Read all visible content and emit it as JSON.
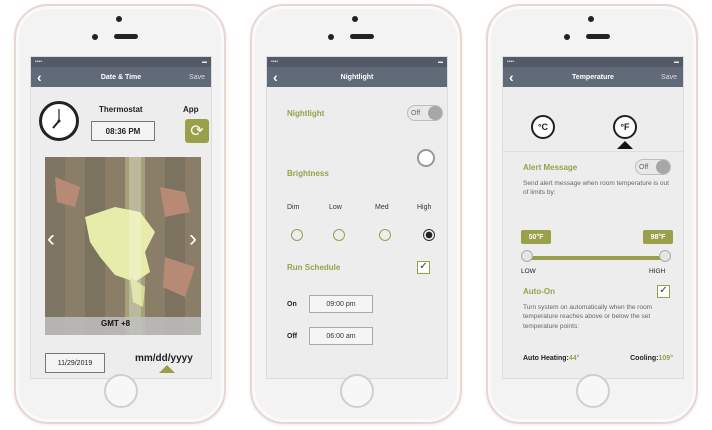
{
  "screens": {
    "date_time": {
      "nav": {
        "back": "‹",
        "title": "Date & Time",
        "save": "Save"
      },
      "thermostat_label": "Thermostat",
      "app_label": "App",
      "time": "08:36 PM",
      "sync_icon": "refresh-icon",
      "gmt": "GMT +8",
      "date": "11/29/2019",
      "date_format": "mm/dd/yyyy"
    },
    "nightlight": {
      "nav": {
        "back": "‹",
        "title": "Nightlight"
      },
      "nightlight_label": "Nightlight",
      "nightlight_toggle": "Off",
      "brightness_label": "Brightness",
      "levels": [
        "Dim",
        "Low",
        "Med",
        "High"
      ],
      "selected_level": "High",
      "run_schedule_label": "Run Schedule",
      "on_label": "On",
      "on_time": "09:00 pm",
      "off_label": "Off",
      "off_time": "06:00 am"
    },
    "temperature": {
      "nav": {
        "back": "‹",
        "title": "Temperature",
        "save": "Save"
      },
      "unit_c": "°C",
      "unit_f": "°F",
      "selected_unit": "°F",
      "alert_label": "Alert Message",
      "alert_toggle": "Off",
      "alert_desc": "Send alert message when room temperature is out of limits by:",
      "low_value": "50°F",
      "high_value": "98°F",
      "low_label": "LOW",
      "high_label": "HIGH",
      "auto_on_label": "Auto-On",
      "auto_on_desc": "Turn system on automatically when the room temperature reaches above or below the set temperature points:",
      "auto_heating_label": "Auto Heating:",
      "auto_heating_value": "44°",
      "cooling_label": "Cooling:",
      "cooling_value": "109°"
    }
  },
  "colors": {
    "accent": "#9aa04a",
    "navbar": "#616a78"
  }
}
